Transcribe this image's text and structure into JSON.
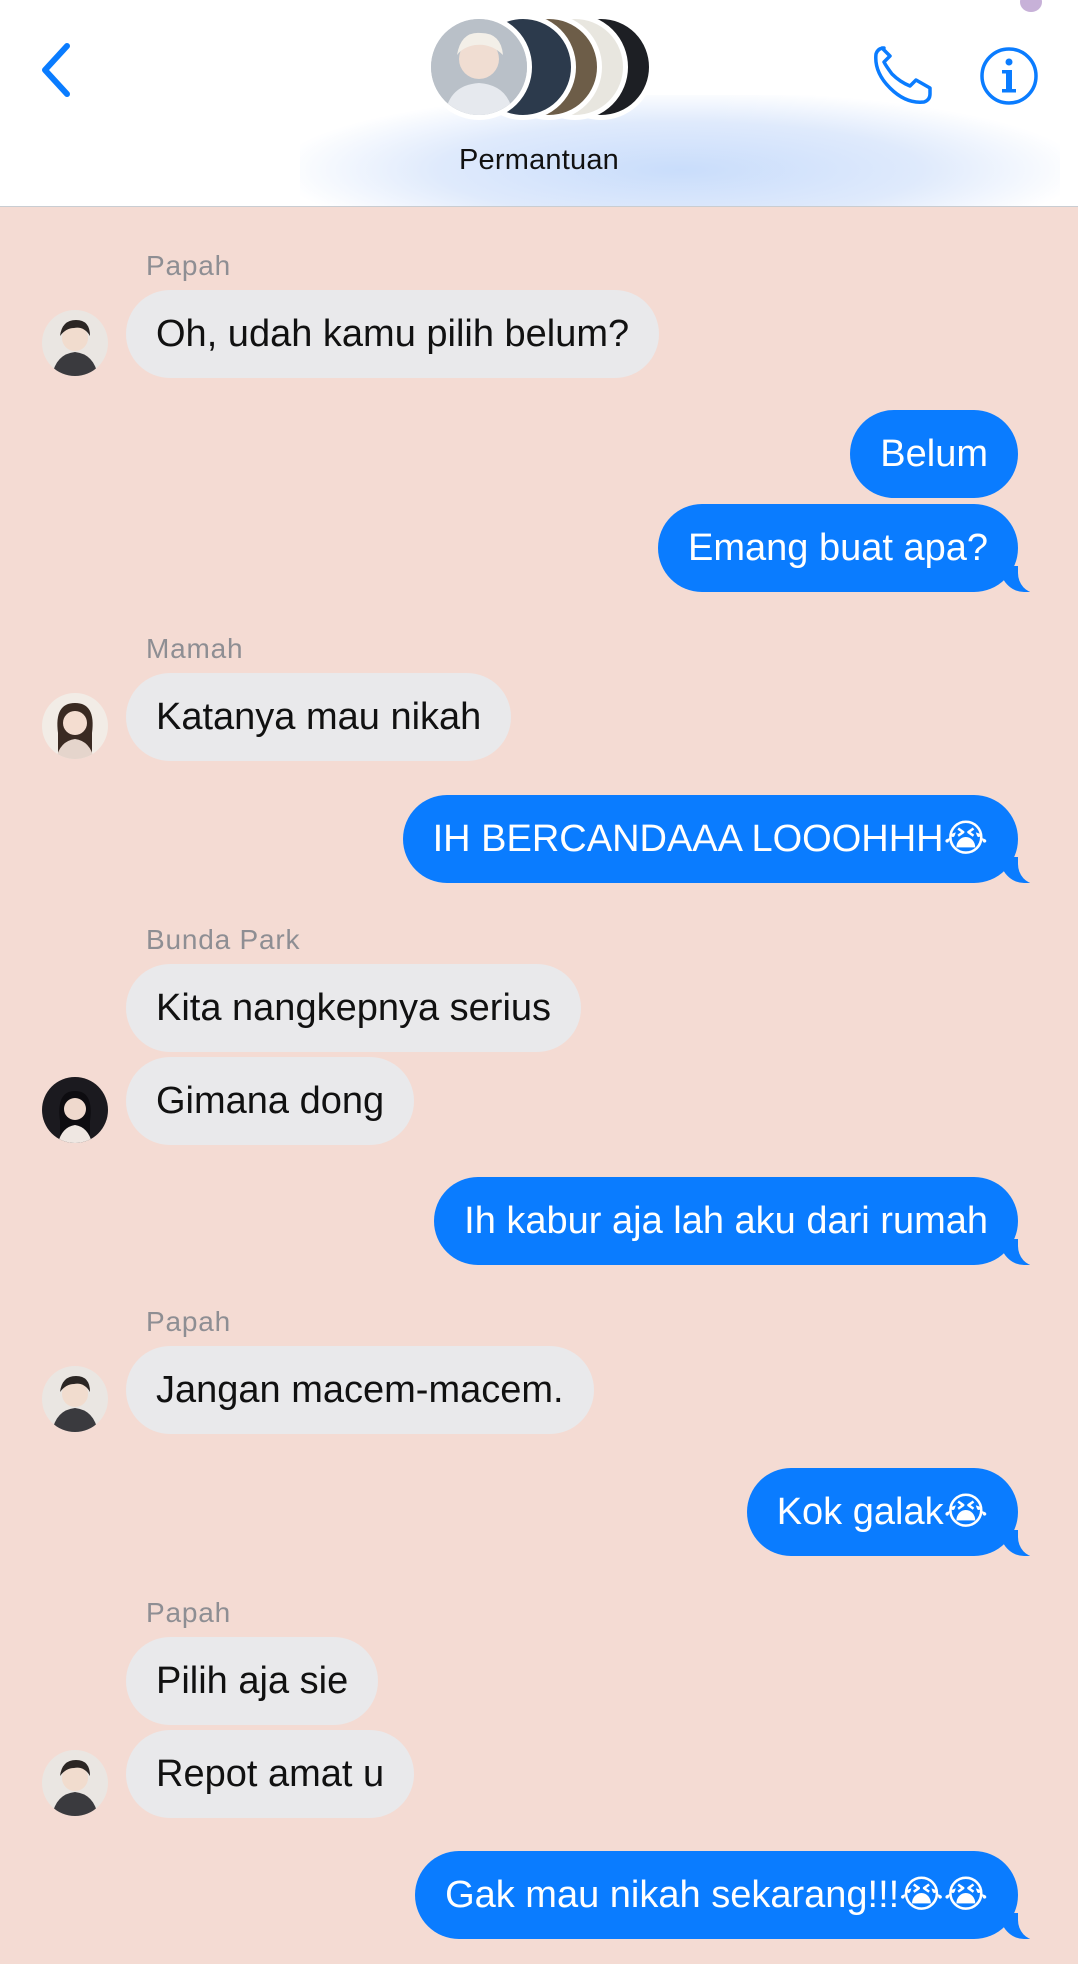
{
  "header": {
    "group_name": "Permantuan"
  },
  "messages": [
    {
      "sender": "Papah",
      "text": "Oh, udah kamu pilih belum?"
    },
    {
      "text": "Belum"
    },
    {
      "text": "Emang buat apa?"
    },
    {
      "sender": "Mamah",
      "text": "Katanya mau nikah"
    },
    {
      "text": "IH BERCANDAAA LOOOHHH😭"
    },
    {
      "sender": "Bunda Park",
      "text": "Kita nangkepnya serius"
    },
    {
      "text": "Gimana dong"
    },
    {
      "text": "Ih kabur aja lah aku dari rumah"
    },
    {
      "sender": "Papah",
      "text": "Jangan macem-macem."
    },
    {
      "text": "Kok galak😭"
    },
    {
      "sender": "Papah",
      "text": "Pilih aja sie"
    },
    {
      "text": "Repot amat u"
    },
    {
      "text": "Gak mau nikah sekarang!!!😭😭"
    }
  ],
  "colors": {
    "background": "#f4dbd3",
    "outgoing_bubble": "#0a7cff",
    "incoming_bubble": "#e9e9eb",
    "accent": "#0a7cff"
  }
}
